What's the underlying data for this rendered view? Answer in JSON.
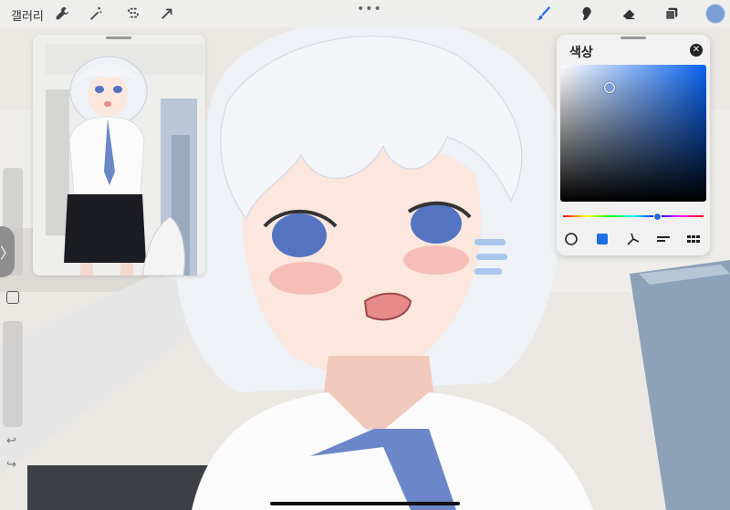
{
  "topbar": {
    "gallery_label": "갤러리",
    "tools_left": [
      "wrench-icon",
      "magic-wand-icon",
      "selection-s-icon",
      "arrow-icon"
    ],
    "more_label": "•••",
    "tools_right": [
      "brush-icon",
      "smudge-icon",
      "eraser-icon",
      "layers-icon"
    ],
    "current_color": "#7b9fd4"
  },
  "sidebar": {
    "toggle_label": "〉",
    "undo_label": "↩",
    "redo_label": "↪"
  },
  "color_panel": {
    "title": "색상",
    "close_label": "✕",
    "hue_color": "#0a63f2",
    "selected_color": "#7b9fd4",
    "modes": [
      "disc-mode-icon",
      "classic-mode-icon",
      "harmony-mode-icon",
      "value-mode-icon",
      "palettes-mode-icon"
    ]
  }
}
